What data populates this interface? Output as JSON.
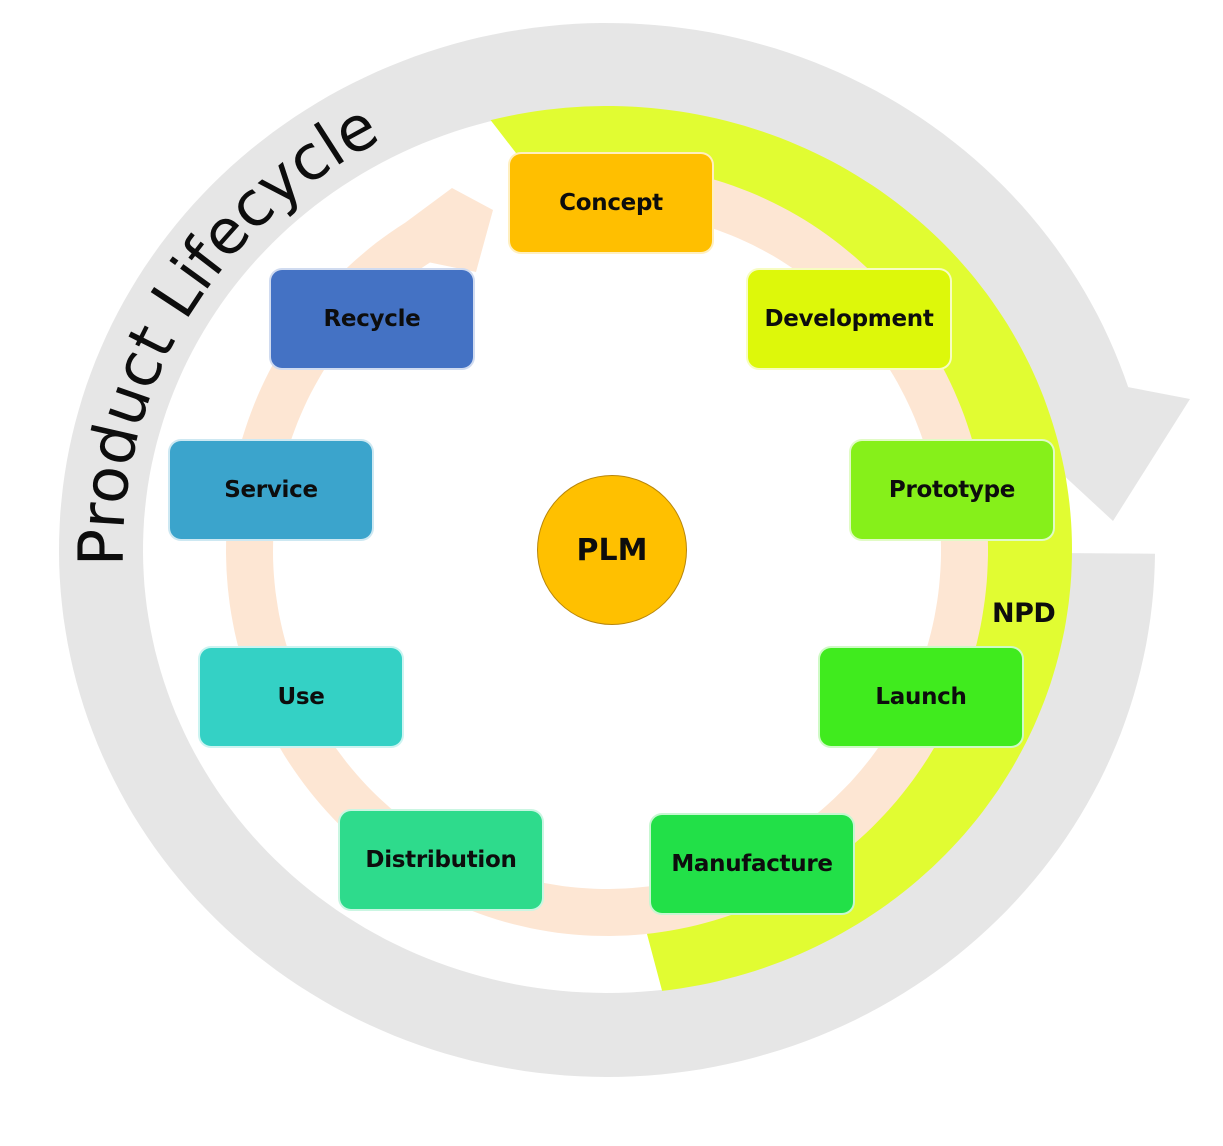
{
  "title": "Product Lifecycle",
  "center": {
    "label": "PLM",
    "color": "#FFC000"
  },
  "npd_label": "NPD",
  "colors": {
    "outer_ring": "#E6E6E6",
    "npd_band": "#E1FC32",
    "inner_ring": "#FDE6D3"
  },
  "stages": [
    {
      "id": "concept",
      "label": "Concept",
      "color": "#FFBF00"
    },
    {
      "id": "development",
      "label": "Development",
      "color": "#DDF80A"
    },
    {
      "id": "prototype",
      "label": "Prototype",
      "color": "#86F01A"
    },
    {
      "id": "launch",
      "label": "Launch",
      "color": "#40EB1E"
    },
    {
      "id": "manufacture",
      "label": "Manufacture",
      "color": "#22E048"
    },
    {
      "id": "distribution",
      "label": "Distribution",
      "color": "#2EDB8C"
    },
    {
      "id": "use",
      "label": "Use",
      "color": "#34D1C5"
    },
    {
      "id": "service",
      "label": "Service",
      "color": "#3BA4CC"
    },
    {
      "id": "recycle",
      "label": "Recycle",
      "color": "#4472C4"
    }
  ]
}
